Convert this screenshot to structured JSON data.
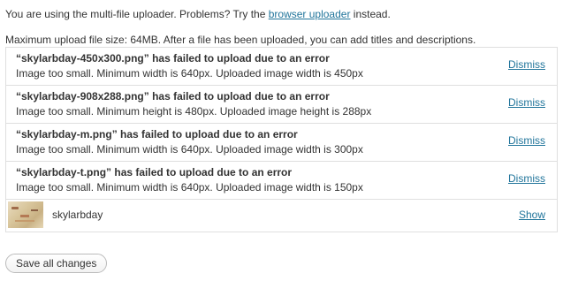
{
  "intro": {
    "text_before": "You are using the multi-file uploader. Problems? Try the ",
    "link_text": "browser uploader",
    "text_after": " instead."
  },
  "max_size_text": "Maximum upload file size: 64MB. After a file has been uploaded, you can add titles and descriptions.",
  "errors": [
    {
      "title": "“skylarbday-450x300.png” has failed to upload due to an error",
      "message": "Image too small. Minimum width is 640px. Uploaded image width is 450px",
      "action": "Dismiss"
    },
    {
      "title": "“skylarbday-908x288.png” has failed to upload due to an error",
      "message": "Image too small. Minimum height is 480px. Uploaded image height is 288px",
      "action": "Dismiss"
    },
    {
      "title": "“skylarbday-m.png” has failed to upload due to an error",
      "message": "Image too small. Minimum width is 640px. Uploaded image width is 300px",
      "action": "Dismiss"
    },
    {
      "title": "“skylarbday-t.png” has failed to upload due to an error",
      "message": "Image too small. Minimum width is 640px. Uploaded image width is 150px",
      "action": "Dismiss"
    }
  ],
  "uploaded_item": {
    "filename": "skylarbday",
    "action": "Show"
  },
  "save_button_label": "Save all changes",
  "colors": {
    "link": "#21759b",
    "border": "#dfdfdf",
    "text": "#333333"
  }
}
